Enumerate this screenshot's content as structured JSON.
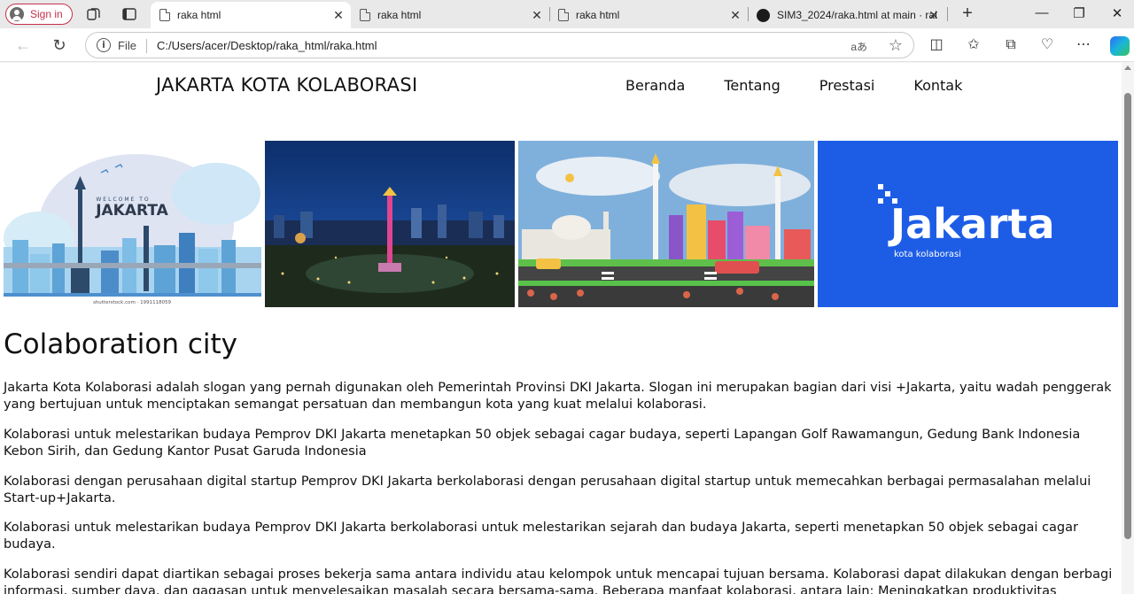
{
  "browser": {
    "profile_label": "Sign in",
    "tabs": [
      {
        "title": "raka html",
        "active": true
      },
      {
        "title": "raka html",
        "active": false
      },
      {
        "title": "raka html",
        "active": false
      },
      {
        "title": "SIM3_2024/raka.html at main · rak",
        "active": false
      }
    ],
    "address": {
      "scheme_label": "File",
      "url": "C:/Users/acer/Desktop/raka_html/raka.html"
    }
  },
  "site": {
    "title": "JAKARTA KOTA KOLABORASI",
    "nav": [
      "Beranda",
      "Tentang",
      "Prestasi",
      "Kontak"
    ],
    "gallery": {
      "img1_welcome": "WELCOME TO",
      "img1_city": "JAKARTA",
      "img1_credit": "shutterstock.com · 1991118059",
      "img4_logo": "Jakarta",
      "img4_tagline": "kota kolaborasi"
    },
    "heading": "Colaboration city",
    "paragraphs": [
      "Jakarta Kota Kolaborasi adalah slogan yang pernah digunakan oleh Pemerintah Provinsi DKI Jakarta. Slogan ini merupakan bagian dari visi +Jakarta, yaitu wadah penggerak yang bertujuan untuk menciptakan semangat persatuan dan membangun kota yang kuat melalui kolaborasi.",
      "Kolaborasi untuk melestarikan budaya Pemprov DKI Jakarta menetapkan 50 objek sebagai cagar budaya, seperti Lapangan Golf Rawamangun, Gedung Bank Indonesia Kebon Sirih, dan Gedung Kantor Pusat Garuda Indonesia",
      "Kolaborasi dengan perusahaan digital startup Pemprov DKI Jakarta berkolaborasi dengan perusahaan digital startup untuk memecahkan berbagai permasalahan melalui Start-up+Jakarta.",
      "Kolaborasi untuk melestarikan budaya Pemprov DKI Jakarta berkolaborasi untuk melestarikan sejarah dan budaya Jakarta, seperti menetapkan 50 objek sebagai cagar budaya.",
      "Kolaborasi sendiri dapat diartikan sebagai proses bekerja sama antara individu atau kelompok untuk mencapai tujuan bersama. Kolaborasi dapat dilakukan dengan berbagi informasi, sumber daya, dan gagasan untuk menyelesaikan masalah secara bersama-sama. Beberapa manfaat kolaborasi, antara lain: Meningkatkan produktivitas"
    ]
  },
  "colors": {
    "accent_red": "#c4314b",
    "logo_blue": "#1d5de6",
    "night_sky": "#0d2f6b"
  }
}
